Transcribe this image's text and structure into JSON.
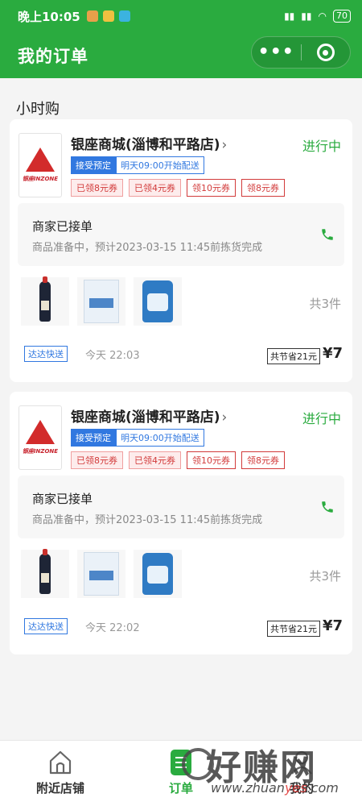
{
  "status_bar": {
    "time": "晚上10:05",
    "battery": "70"
  },
  "header": {
    "title": "我的订单",
    "more_label": "•••"
  },
  "section_title": "小时购",
  "orders": [
    {
      "store_name": "银座商城(淄博和平路店)",
      "logo_text": "银座INZONE",
      "status": "进行中",
      "tag_mode": "接受预定",
      "tag_delivery_time": "明天09:00开始配送",
      "coupons": [
        "已领8元券",
        "已领4元券",
        "领10元券",
        "领8元券"
      ],
      "notice_title": "商家已接单",
      "notice_detail": "商品准备中，预计2023-03-15 11:45前拣货完成",
      "item_count": "共3件",
      "delivery_service": "达达快送",
      "order_time": "今天 22:03",
      "savings": "共节省21元",
      "price": "¥7"
    },
    {
      "store_name": "银座商城(淄博和平路店)",
      "logo_text": "银座INZONE",
      "status": "进行中",
      "tag_mode": "接受预定",
      "tag_delivery_time": "明天09:00开始配送",
      "coupons": [
        "已领8元券",
        "已领4元券",
        "领10元券",
        "领8元券"
      ],
      "notice_title": "商家已接单",
      "notice_detail": "商品准备中，预计2023-03-15 11:45前拣货完成",
      "item_count": "共3件",
      "delivery_service": "达达快送",
      "order_time": "今天 22:02",
      "savings": "共节省21元",
      "price": "¥7"
    }
  ],
  "tabbar": {
    "tabs": [
      {
        "label": "附近店铺",
        "icon": "home-icon"
      },
      {
        "label": "订单",
        "icon": "order-list-icon"
      },
      {
        "label": "我的",
        "icon": "profile-icon"
      }
    ],
    "active_color": "#2aab3f"
  },
  "watermark": {
    "text": "好赚网",
    "url_prefix": "www.zhuan",
    "url_highlight": "yes",
    "url_suffix": ".com"
  },
  "colors": {
    "brand_green": "#2aab3f",
    "tag_blue": "#3178e0",
    "coupon_red": "#d23b3b"
  }
}
